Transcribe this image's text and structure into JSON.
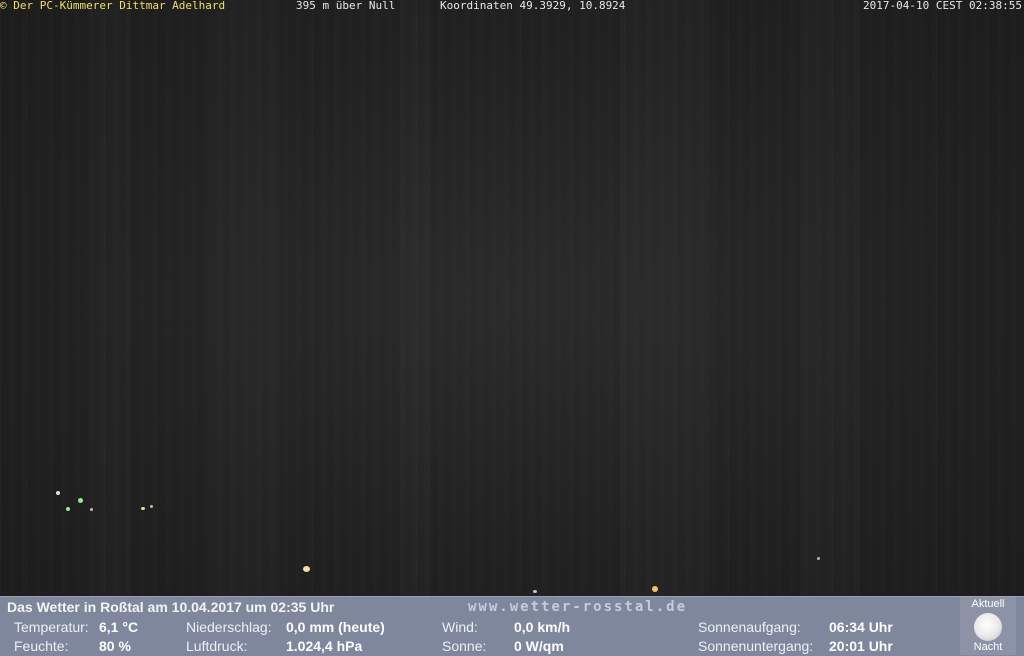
{
  "overlay": {
    "credit": "© Der PC-Kümmerer Dittmar Adelhard",
    "altitude": "395 m über Null",
    "coordinates": "Koordinaten 49.3929, 10.8924",
    "timestamp": "2017-04-10 CEST 02:38:55"
  },
  "weather": {
    "title": "Das Wetter in Roßtal am 10.04.2017 um 02:35 Uhr",
    "website": "www.wetter-rosstal.de",
    "temperature": {
      "label": "Temperatur:",
      "value": "6,1 °C"
    },
    "humidity": {
      "label": "Feuchte:",
      "value": "80 %"
    },
    "precipitation": {
      "label": "Niederschlag:",
      "value": "0,0 mm (heute)"
    },
    "pressure": {
      "label": "Luftdruck:",
      "value": "1.024,4 hPa"
    },
    "wind": {
      "label": "Wind:",
      "value": "0,0 km/h"
    },
    "sun": {
      "label": "Sonne:",
      "value": "0 W/qm"
    },
    "sunrise": {
      "label": "Sonnenaufgang:",
      "value": "06:34 Uhr"
    },
    "sunset": {
      "label": "Sonnenuntergang:",
      "value": "20:01 Uhr"
    },
    "moon": {
      "top_label": "Aktuell",
      "bottom_label": "Nacht",
      "icon": "full-moon-icon"
    }
  },
  "colors": {
    "bar_background": "#7f879d",
    "credit_text": "#f0e060",
    "light_green": "#8df08a",
    "light_orange": "#f6c060"
  }
}
